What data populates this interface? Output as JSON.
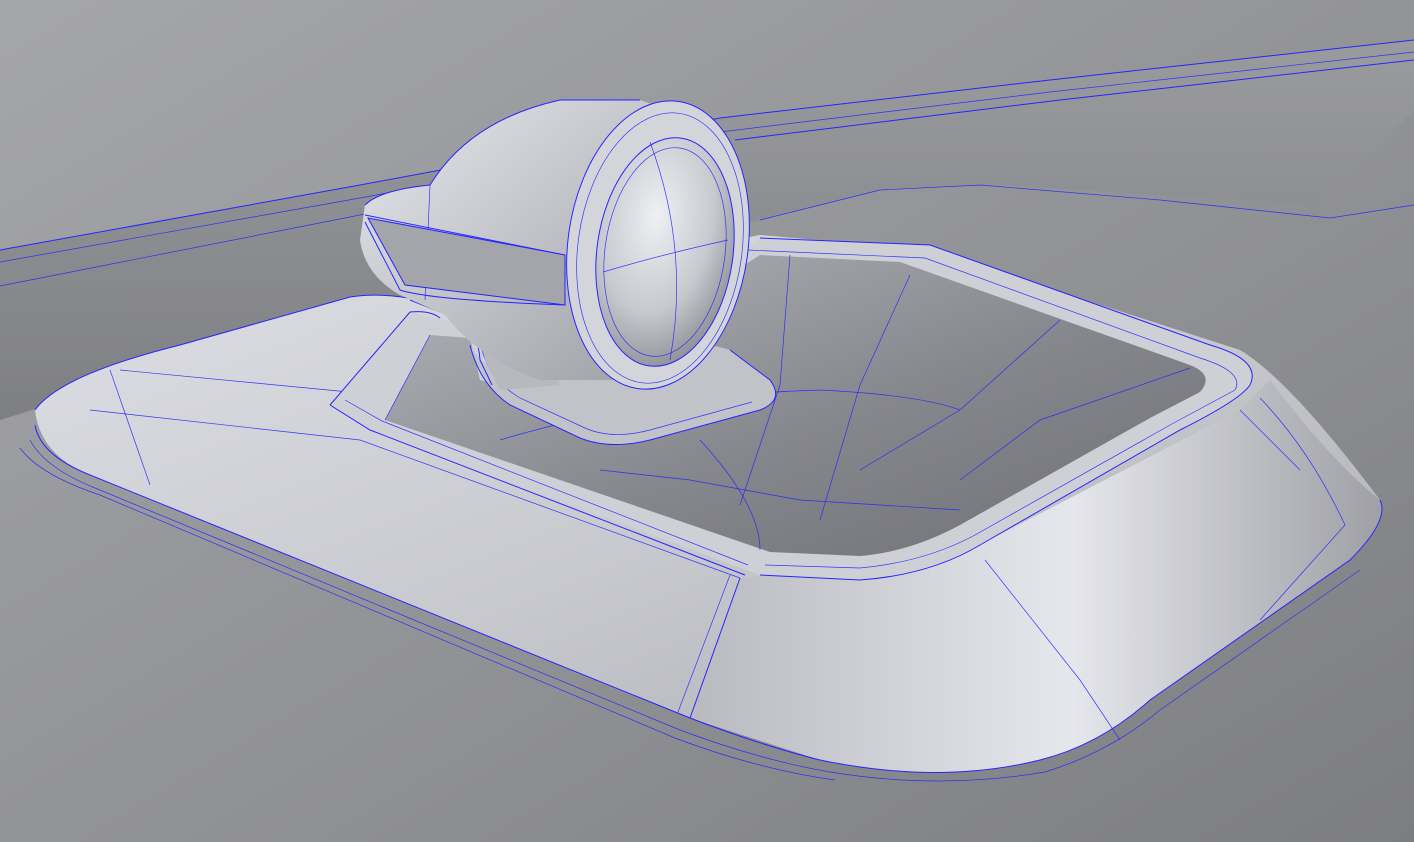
{
  "scene": {
    "description_visible_text": "",
    "edge_color": "#2525ff",
    "background_color": "#8a8b8f",
    "surface_light": "#e4e5ea",
    "surface_mid": "#b4b5ba",
    "surface_dark": "#6d6e73"
  }
}
